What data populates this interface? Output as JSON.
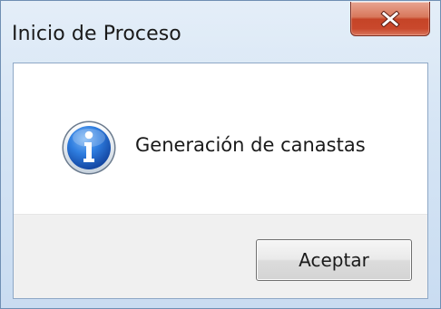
{
  "window": {
    "title": "Inicio de Proceso",
    "close_icon": "close-icon"
  },
  "dialog": {
    "icon": "info-icon",
    "message": "Generación de canastas",
    "ok_label": "Aceptar"
  },
  "colors": {
    "close_button": "#c9482c",
    "info_icon": "#1f64c8",
    "button_area": "#f0f0f0"
  }
}
